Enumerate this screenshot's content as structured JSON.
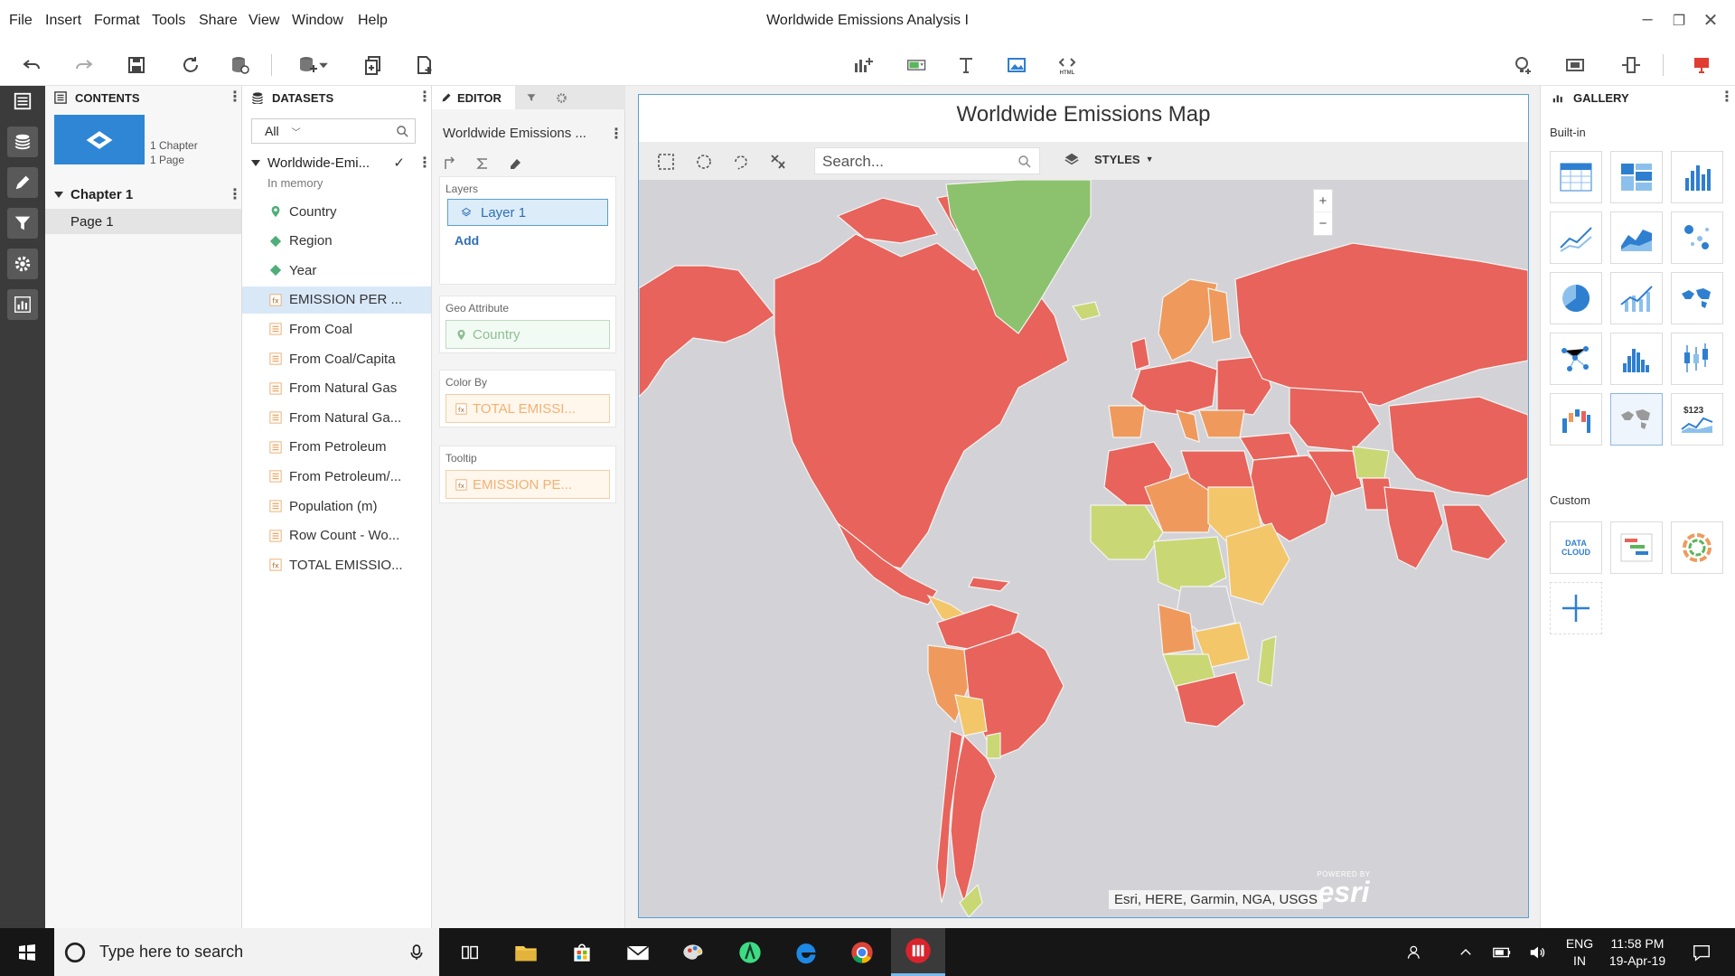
{
  "menu": [
    "File",
    "Insert",
    "Format",
    "Tools",
    "Share",
    "View",
    "Window",
    "Help"
  ],
  "window_title": "Worldwide Emissions Analysis I",
  "contents": {
    "header": "CONTENTS",
    "summary_chapter": "1 Chapter",
    "summary_page": "1 Page",
    "chapter_label": "Chapter 1",
    "page_label": "Page 1"
  },
  "datasets": {
    "header": "DATASETS",
    "filter_value": "All",
    "dataset_name": "Worldwide-Emi...",
    "dataset_status": "In memory",
    "items": [
      {
        "label": "Country",
        "type": "geo"
      },
      {
        "label": "Region",
        "type": "attr"
      },
      {
        "label": "Year",
        "type": "attr"
      },
      {
        "label": "EMISSION PER ...",
        "type": "derived"
      },
      {
        "label": "From Coal",
        "type": "metric"
      },
      {
        "label": "From Coal/Capita",
        "type": "metric"
      },
      {
        "label": "From Natural Gas",
        "type": "metric"
      },
      {
        "label": "From Natural Ga...",
        "type": "metric"
      },
      {
        "label": "From Petroleum",
        "type": "metric"
      },
      {
        "label": "From Petroleum/...",
        "type": "metric"
      },
      {
        "label": "Population (m)",
        "type": "metric"
      },
      {
        "label": "Row Count - Wo...",
        "type": "metric"
      },
      {
        "label": "TOTAL EMISSIO...",
        "type": "derived"
      }
    ]
  },
  "editor": {
    "tab": "EDITOR",
    "viz_name": "Worldwide Emissions ...",
    "layers_label": "Layers",
    "layer_name": "Layer 1",
    "add_label": "Add",
    "geo_label": "Geo Attribute",
    "geo_value": "Country",
    "colorby_label": "Color By",
    "colorby_value": "TOTAL EMISSI...",
    "tooltip_label": "Tooltip",
    "tooltip_value": "EMISSION PE..."
  },
  "map": {
    "title": "Worldwide Emissions Map",
    "search_placeholder": "Search...",
    "styles_label": "STYLES",
    "zoom_in": "+",
    "zoom_out": "−",
    "attribution": "Esri, HERE, Garmin, NGA, USGS",
    "powered_by": "POWERED BY",
    "esri_logo": "esri",
    "colors": {
      "high": "#e8635b",
      "mid": "#ef9a5c",
      "low": "#f3c66a",
      "lower": "#c9d874",
      "lowest": "#8cc26d",
      "nodata": "#cfcfd3",
      "water": "#d3d3d7"
    }
  },
  "gallery": {
    "header": "GALLERY",
    "builtin_label": "Built-in",
    "custom_label": "Custom",
    "kpi_text": "$123",
    "datacloud_text": "DATA CLOUD"
  },
  "taskbar": {
    "search_placeholder": "Type here to search",
    "lang_top": "ENG",
    "lang_bottom": "IN",
    "time": "11:58 PM",
    "date": "19-Apr-19"
  }
}
